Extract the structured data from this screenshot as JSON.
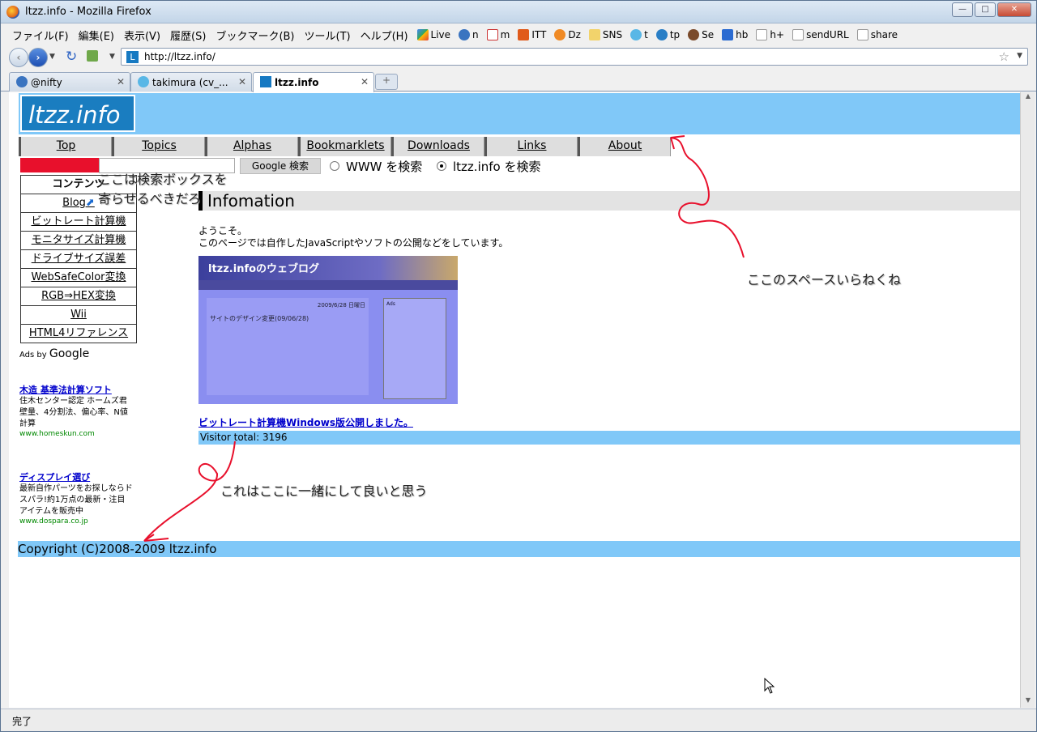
{
  "window": {
    "title": "ltzz.info - Mozilla Firefox"
  },
  "menubar": {
    "menus": [
      "ファイル(F)",
      "編集(E)",
      "表示(V)",
      "履歴(S)",
      "ブックマーク(B)",
      "ツール(T)",
      "ヘルプ(H)"
    ],
    "bookmarks": [
      "Live",
      "n",
      "m",
      "ITT",
      "Dz",
      "SNS",
      "t",
      "tp",
      "Se",
      "hb",
      "h+",
      "sendURL",
      "share"
    ]
  },
  "navbar": {
    "url": "http://ltzz.info/"
  },
  "tabs": [
    {
      "label": "@nifty",
      "active": false
    },
    {
      "label": "takimura (cv_...",
      "active": false
    },
    {
      "label": "ltzz.info",
      "active": true
    }
  ],
  "site": {
    "logo": "ltzz.info",
    "nav": [
      "Top",
      "Topics",
      "Alphas",
      "Bookmarklets",
      "Downloads",
      "Links",
      "About"
    ],
    "search": {
      "button": "Google 検索",
      "option_www": "WWW を検索",
      "option_site": "ltzz.info を検索"
    },
    "side": {
      "header": "コンテンツ",
      "items": [
        "Blog",
        "ビットレート計算機",
        "モニタサイズ計算機",
        "ドライブサイズ誤差",
        "WebSafeColor変換",
        "RGB⇒HEX変換",
        "Wii",
        "HTML4リファレンス"
      ]
    },
    "ads": {
      "ads_by": "Ads by",
      "google": "Google",
      "items": [
        {
          "title": "木造 基準法計算ソフト",
          "body": "住木センター認定 ホームズ君 壁量、4分割法、偏心率、N値計算",
          "url": "www.homeskun.com"
        },
        {
          "title": "ディスプレイ選び",
          "body": "最新自作パーツをお探しならドスパラ!約1万点の最新・注目アイテムを販売中",
          "url": "www.dospara.co.jp"
        }
      ]
    },
    "main": {
      "heading": "Infomation",
      "welcome_1": "ようこそ。",
      "welcome_2": "このページでは自作したJavaScriptやソフトの公開などをしています。",
      "blog_shot": {
        "title": "ltzz.infoのウェブログ",
        "post": "サイトのデザイン変更(09/06/28)",
        "date": "2009/6/28 日曜日",
        "side_ads": "Ads"
      },
      "news_link": "ビットレート計算機Windows版公開しました。",
      "visitor": "Visitor total: 3196"
    },
    "footer": "Copyright (C)2008-2009 ltzz.info"
  },
  "annotations": {
    "search_note_1": "ここは検索ボックスを",
    "search_note_2": "寄らせるべきだろ",
    "space_note": "ここのスペースいらねくね",
    "visitor_note": "これはここに一緒にして良いと思う"
  },
  "status": {
    "text": "完了"
  },
  "colors": {
    "header_blue": "#80c8f8",
    "logo_blue": "#1a7dc0",
    "search_red": "#e8102c",
    "annotation_red": "#e8102c"
  }
}
